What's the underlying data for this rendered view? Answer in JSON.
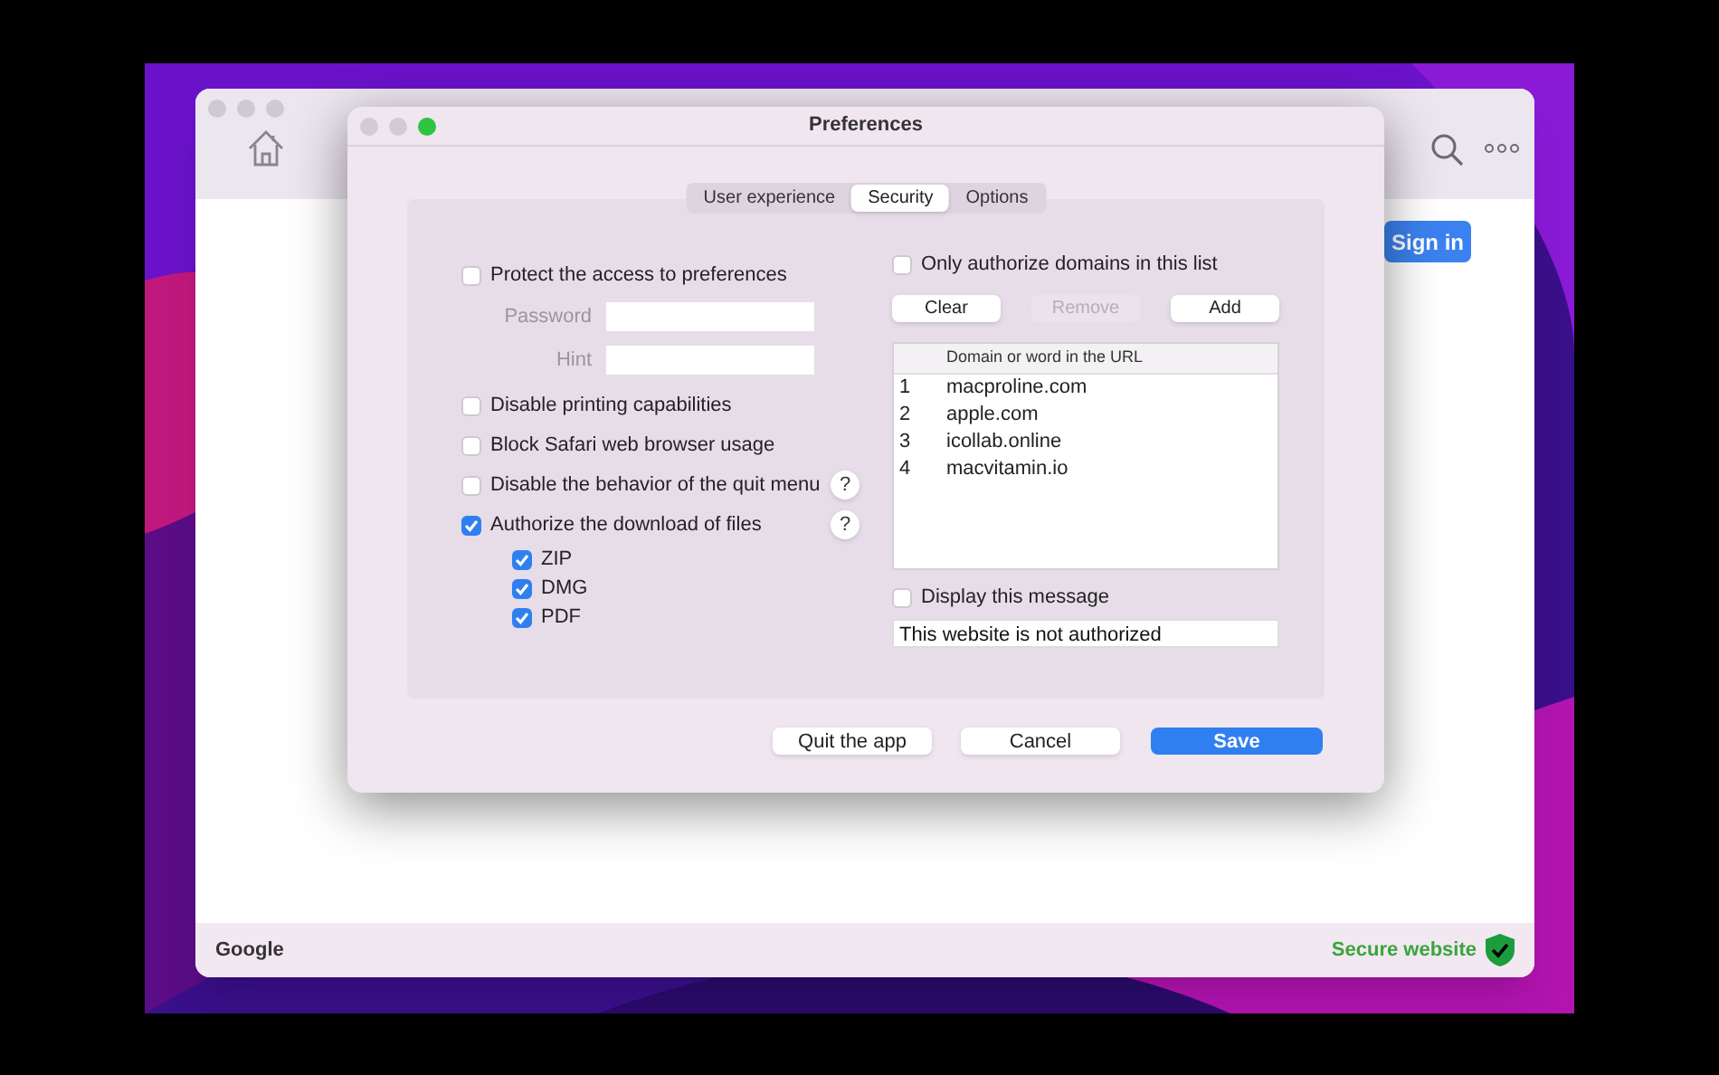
{
  "main_window": {
    "sign_in": "Sign in",
    "status_left": "Google",
    "status_right": "Secure website"
  },
  "dialog": {
    "title": "Preferences",
    "tabs": [
      {
        "label": "User experience",
        "selected": false
      },
      {
        "label": "Security",
        "selected": true
      },
      {
        "label": "Options",
        "selected": false
      }
    ],
    "options": [
      {
        "label": "Protect the access to preferences",
        "checked": false,
        "fields": [
          {
            "label": "Password"
          },
          {
            "label": "Hint"
          }
        ]
      },
      {
        "label": "Disable printing capabilities",
        "checked": false
      },
      {
        "label": "Block Safari web browser usage",
        "checked": false
      },
      {
        "label": "Disable the behavior of the quit menu",
        "checked": false,
        "help": "?"
      },
      {
        "label": "Authorize the download of files",
        "checked": true,
        "help": "?",
        "children": [
          {
            "label": "ZIP",
            "checked": true
          },
          {
            "label": "DMG",
            "checked": true
          },
          {
            "label": "PDF",
            "checked": true
          }
        ]
      }
    ],
    "domain_filter": {
      "label": "Only authorize domains in this list",
      "checked": false
    },
    "list_buttons": [
      {
        "label": "Clear",
        "disabled": false
      },
      {
        "label": "Remove",
        "disabled": true
      },
      {
        "label": "Add",
        "disabled": false
      }
    ],
    "table": {
      "columns": [
        "Domain or word in the URL"
      ],
      "rows": [
        {
          "index": "1",
          "domain": "macproline.com"
        },
        {
          "index": "2",
          "domain": "apple.com"
        },
        {
          "index": "3",
          "domain": "icollab.online"
        },
        {
          "index": "4",
          "domain": "macvitamin.io"
        }
      ]
    },
    "message": {
      "label": "Display this message",
      "checked": false,
      "value": "This website is not authorized"
    },
    "buttons": [
      {
        "label": "Quit the app",
        "primary": false
      },
      {
        "label": "Cancel",
        "primary": false
      },
      {
        "label": "Save",
        "primary": true
      }
    ]
  }
}
